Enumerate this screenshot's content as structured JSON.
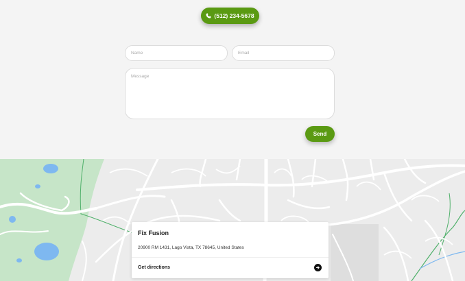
{
  "contact": {
    "phone_label": "(512) 234-5678"
  },
  "form": {
    "name_placeholder": "Name",
    "email_placeholder": "Email",
    "message_placeholder": "Message",
    "send_label": "Send"
  },
  "map": {
    "business_name": "Fix Fusion",
    "address": "20900 RM 1431, Lago Vista, TX 78645, United States",
    "directions_label": "Get directions"
  },
  "colors": {
    "accent": "#5a9a12",
    "map_green": "#c6e5c8",
    "map_water": "#7eb8f0",
    "map_road": "#ffffff"
  },
  "icons": {
    "phone": "phone-icon",
    "directions": "arrow-right-icon"
  }
}
